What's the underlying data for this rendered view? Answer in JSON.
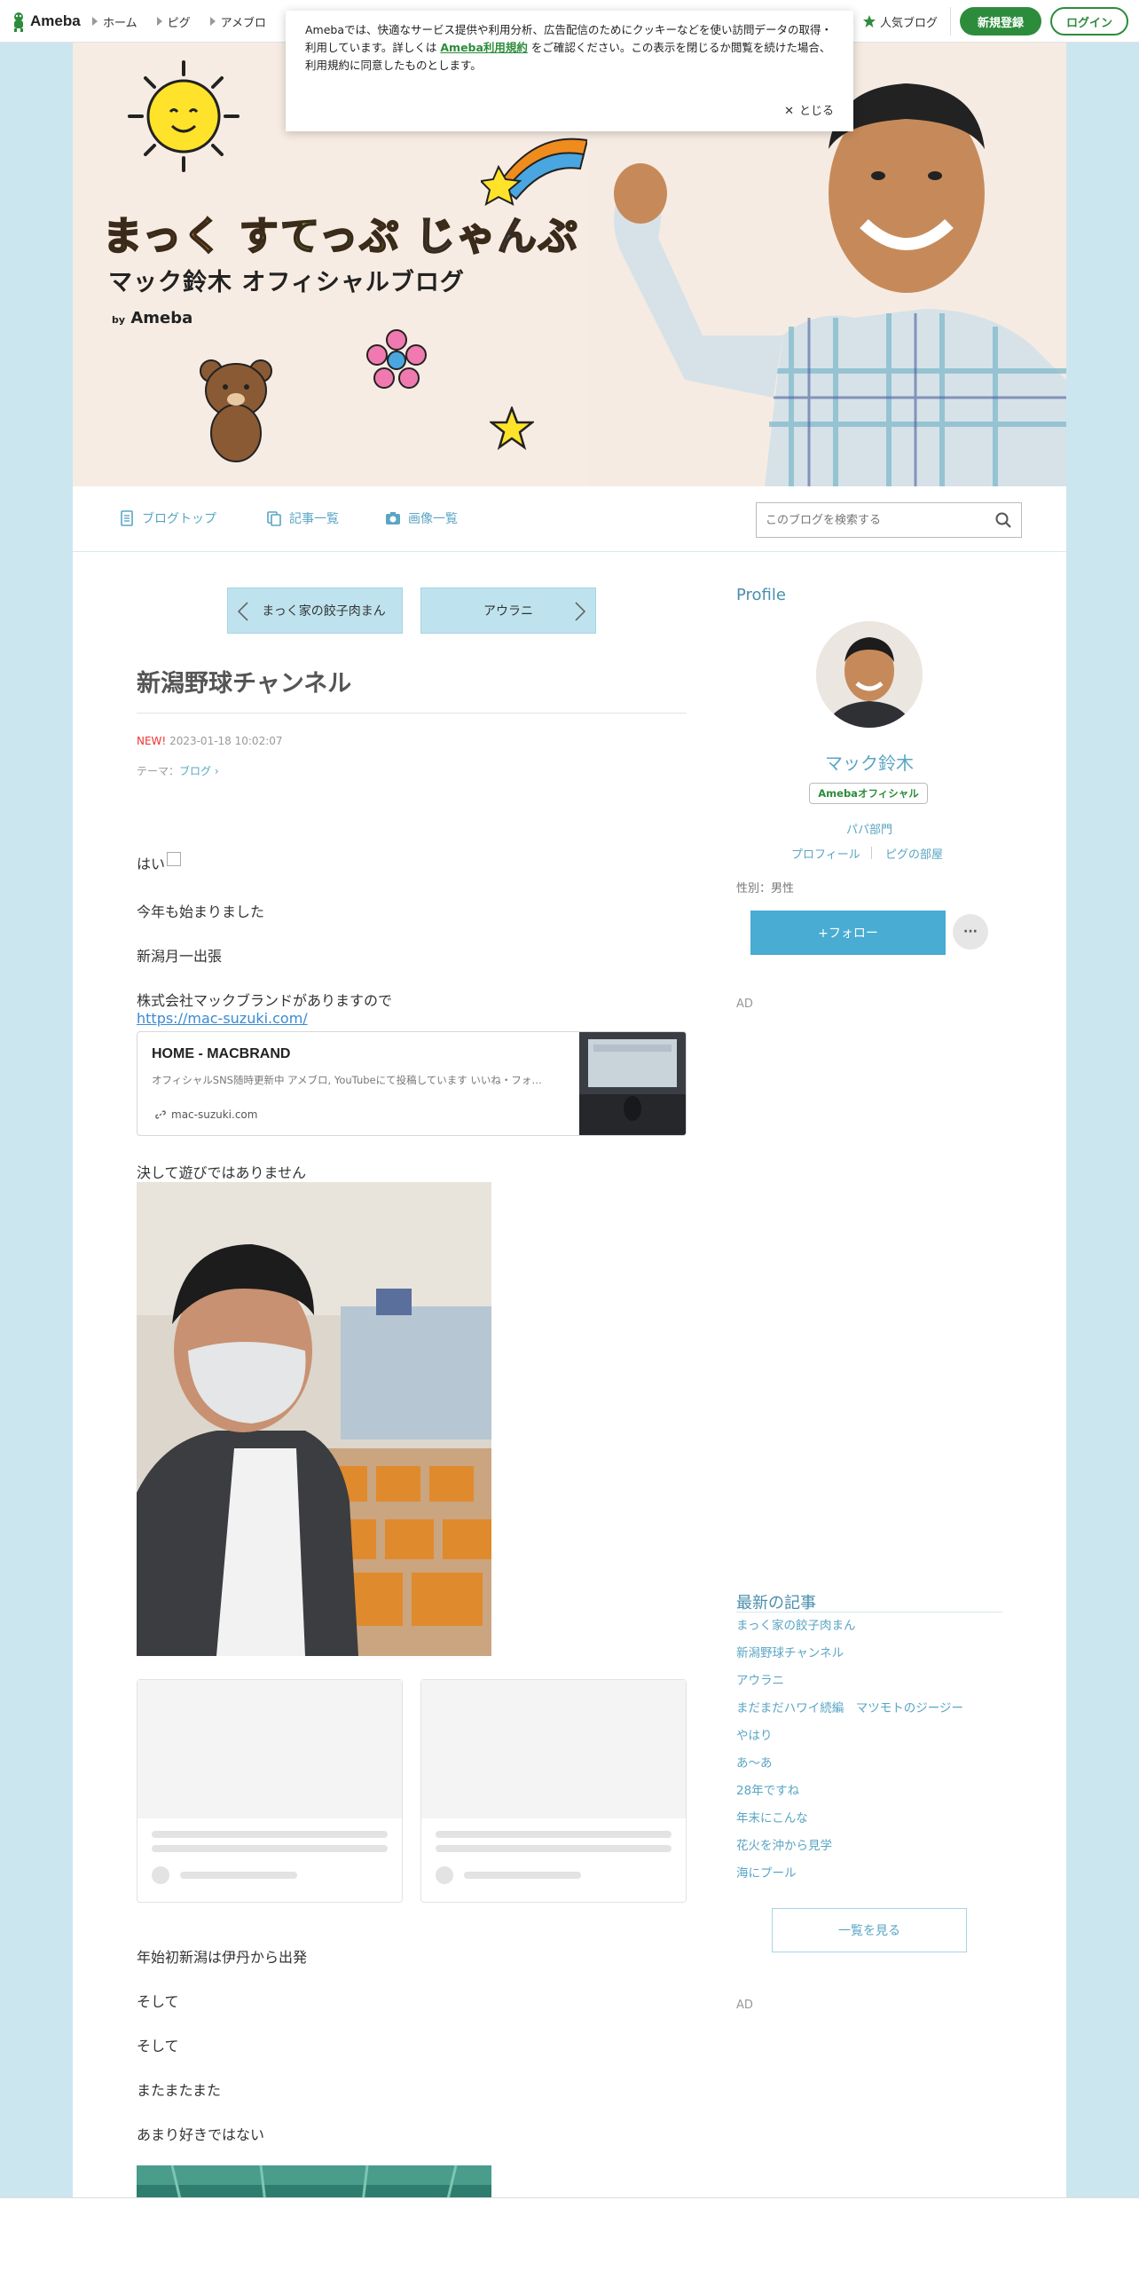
{
  "topbar": {
    "logo": "Ameba",
    "nav": [
      "ホーム",
      "ピグ",
      "アメブロ"
    ],
    "popular": "人気ブログ",
    "register": "新規登録",
    "login": "ログイン"
  },
  "cookie": {
    "text_before": "Amebaでは、快適なサービス提供や利用分析、広告配信のためにクッキーなどを使い訪問データの取得・利用しています。詳しくは",
    "link": "Ameba利用規約",
    "text_after": "をご確認ください。この表示を閉じるか閲覧を続けた場合、利用規約に同意したものとします。",
    "close": "とじる"
  },
  "header": {
    "title_part1": "まっく",
    "title_part2": "すてっぷ",
    "title_part3": "じゃんぷ",
    "subtitle": "マック鈴木 オフィシャルブログ",
    "by": "by",
    "by_brand": "Ameba"
  },
  "blognav": {
    "top": "ブログトップ",
    "list": "記事一覧",
    "images": "画像一覧",
    "search_placeholder": "このブログを検索する"
  },
  "article": {
    "prev": "まっく家の餃子肉まん",
    "next": "アウラニ",
    "title": "新潟野球チャンネル",
    "new_label": "NEW!",
    "date": "2023-01-18 10:02:07",
    "theme_label": "テーマ：",
    "theme": "ブログ",
    "p1": "はい",
    "p2": "今年も始まりました",
    "p3": "新潟月一出張",
    "p4": "株式会社マックブランドがありますので",
    "url": "https://mac-suzuki.com/",
    "card": {
      "title": "HOME - MACBRAND",
      "desc": "オフィシャルSNS随時更新中 アメブロ, YouTubeにて投稿しています いいね・フォ…",
      "domain": "mac-suzuki.com"
    },
    "p5": "決して遊びではありません",
    "p6": "年始初新潟は伊丹から出発",
    "p7": "そして",
    "p8": "そして",
    "p9": "またまたまた",
    "p10": "あまり好きではない"
  },
  "sidebar": {
    "profile_heading": "Profile",
    "name": "マック鈴木",
    "badge": "Amebaオフィシャル",
    "category": "パパ部門",
    "profile_link": "プロフィール",
    "pigg_link": "ピグの部屋",
    "gender": "性別：男性",
    "follow": "+フォロー",
    "more": "···",
    "ad1": "AD",
    "recent_heading": "最新の記事",
    "recent": [
      "まっく家の餃子肉まん",
      "新潟野球チャンネル",
      "アウラニ",
      "まだまだハワイ続編　マツモトのジージー",
      "やはり",
      "あ〜あ",
      "28年ですね",
      "年末にこんな",
      "花火を沖から見学",
      "海にプール"
    ],
    "see_all": "一覧を見る",
    "ad2": "AD"
  }
}
